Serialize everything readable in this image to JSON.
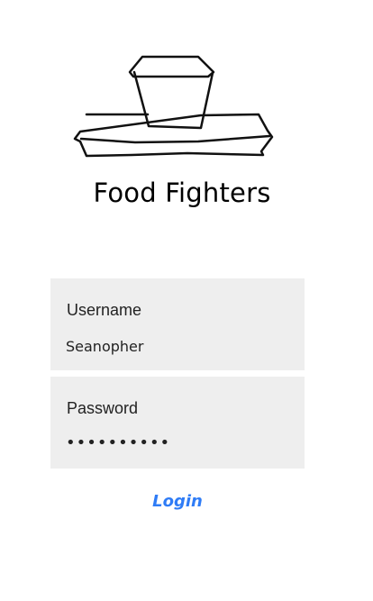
{
  "app": {
    "title": "Food Fighters",
    "logo_icon": "food-tray-icon"
  },
  "form": {
    "username": {
      "label": "Username",
      "value": "Seanopher"
    },
    "password": {
      "label": "Password",
      "value": "••••••••••"
    },
    "login_label": "Login"
  },
  "colors": {
    "field_background": "#eeeeee",
    "link": "#2f7cf6",
    "text": "#000000"
  }
}
